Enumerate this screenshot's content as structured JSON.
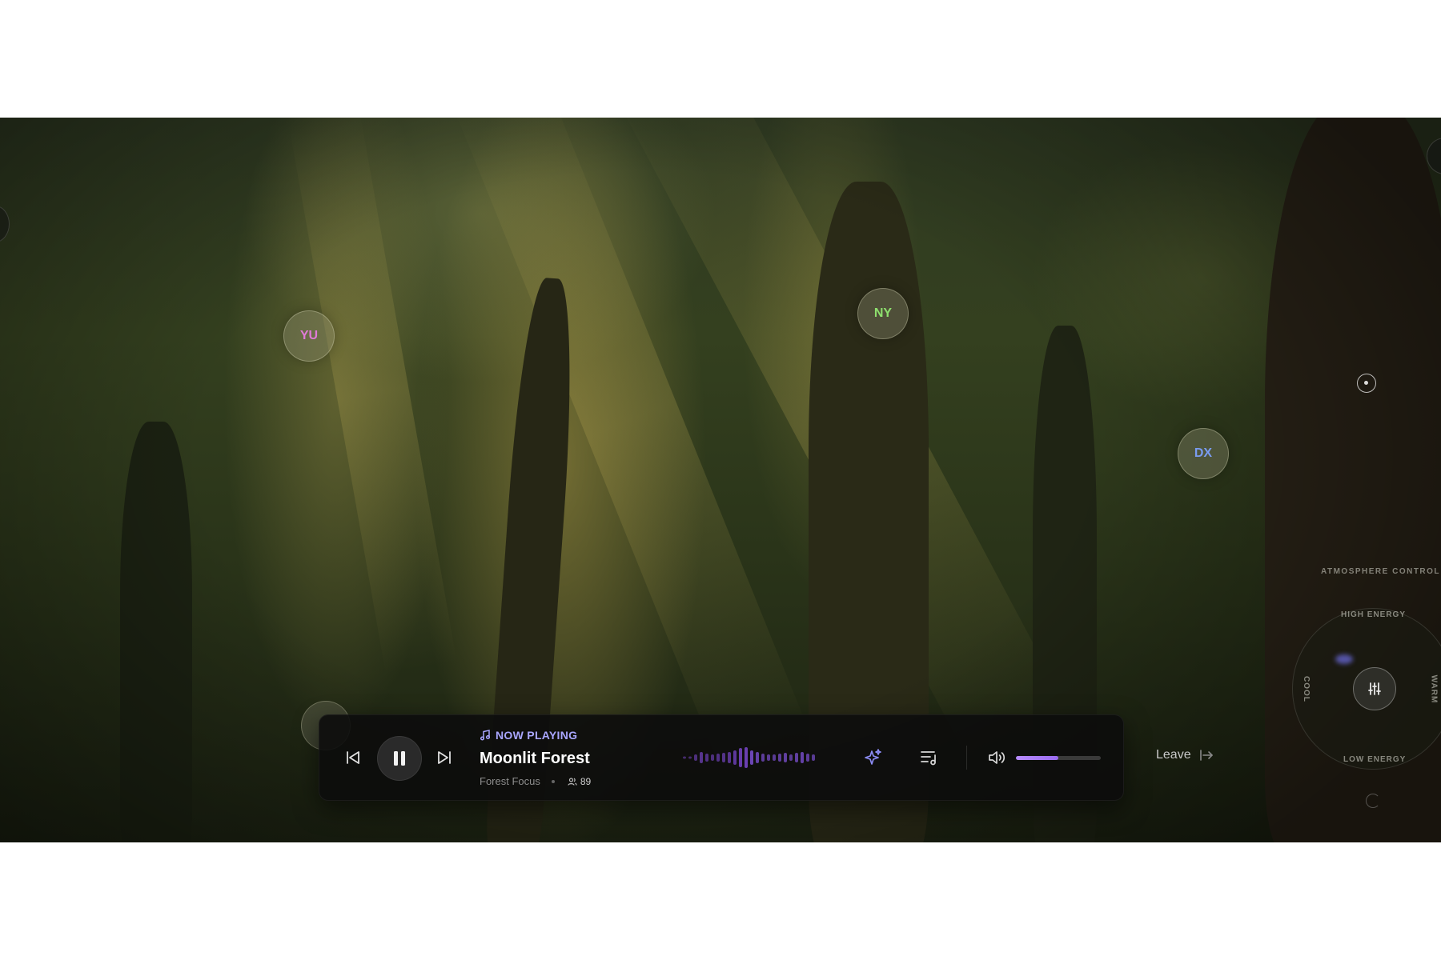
{
  "participants": [
    {
      "initials": "YU",
      "color": "#e07ad8"
    },
    {
      "initials": "NY",
      "color": "#8ee06e"
    },
    {
      "initials": "DX",
      "color": "#7a9cf0"
    }
  ],
  "atmosphere": {
    "title": "ATMOSPHERE  CONTROL",
    "top_label": "HIGH ENERGY",
    "bottom_label": "LOW ENERGY",
    "left_label": "COOL",
    "right_label": "WARM",
    "knob_icon": "sliders-icon"
  },
  "player": {
    "now_playing_label": "NOW PLAYING",
    "track_title": "Moonlit Forest",
    "room_name": "Forest Focus",
    "listener_count": "89",
    "volume": 0.5,
    "accent": "#a9a6ff",
    "icons": {
      "prev": "skip-back-icon",
      "pause": "pause-icon",
      "next": "skip-forward-icon",
      "music": "music-note-icon",
      "sparkle": "sparkle-icon",
      "queue": "playlist-icon",
      "volume": "volume-icon",
      "listeners": "users-icon"
    }
  },
  "leave_label": "Leave"
}
